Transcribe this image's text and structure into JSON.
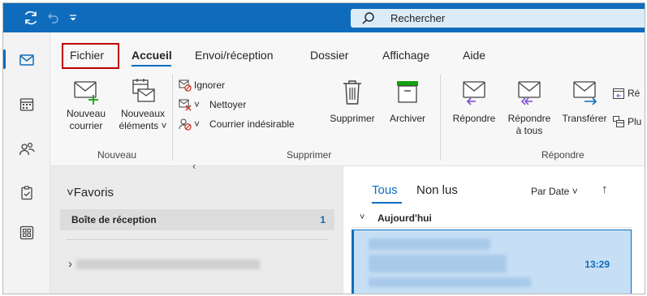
{
  "titlebar": {
    "sync_icon": "sync-icon",
    "undo_icon": "undo-icon",
    "customize_icon": "customize-quick-access-icon",
    "search_placeholder": "Rechercher"
  },
  "rail": {
    "items": [
      {
        "icon": "mail-icon"
      },
      {
        "icon": "calendar-icon"
      },
      {
        "icon": "people-icon"
      },
      {
        "icon": "tasks-icon"
      },
      {
        "icon": "apps-icon"
      }
    ]
  },
  "ribbon": {
    "tabs": [
      "Fichier",
      "Accueil",
      "Envoi/réception",
      "Dossier",
      "Affichage",
      "Aide"
    ],
    "active_tab": "Accueil",
    "nouveau": {
      "new_mail_line1": "Nouveau",
      "new_mail_line2": "courrier",
      "new_items_line1": "Nouveaux",
      "new_items_line2": "éléments",
      "group_label": "Nouveau"
    },
    "supprimer": {
      "ignore": "Ignorer",
      "clean": "Nettoyer",
      "junk": "Courrier indésirable",
      "delete": "Supprimer",
      "archive": "Archiver",
      "group_label": "Supprimer"
    },
    "repondre": {
      "reply": "Répondre",
      "reply_all_line1": "Répondre",
      "reply_all_line2": "à tous",
      "forward": "Transférer",
      "meeting_partial": "Ré",
      "more_partial": "Plu",
      "group_label": "Répondre"
    }
  },
  "folder_pane": {
    "collapse_glyph": "‹",
    "favorites": "Favoris",
    "inbox_label": "Boîte de réception",
    "inbox_count": "1"
  },
  "mail_list": {
    "tabs": [
      "Tous",
      "Non lus"
    ],
    "active_tab": "Tous",
    "sort_label": "Par Date",
    "group_header": "Aujourd'hui",
    "item_time": "13:29"
  },
  "colors": {
    "accent": "#0f6cbd",
    "highlight_box": "#c00000",
    "selected_item": "#c7dff5"
  }
}
